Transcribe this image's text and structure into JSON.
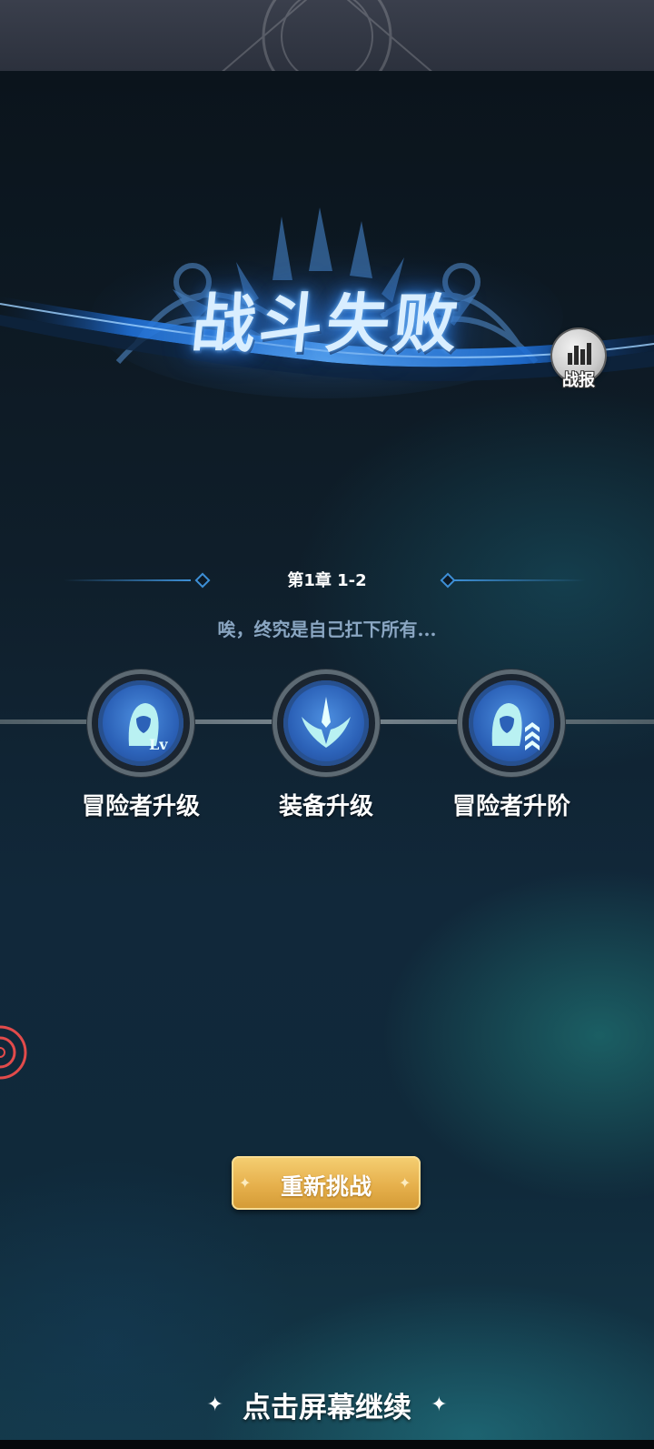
{
  "result": {
    "title": "战斗失败",
    "report_label": "战报"
  },
  "stage": {
    "chapter": "第1章 1-2",
    "subtitle": "唉，终究是自己扛下所有..."
  },
  "tips": [
    {
      "label": "冒险者升级",
      "icon": "adventurer-level-up-icon"
    },
    {
      "label": "装备升级",
      "icon": "equipment-upgrade-icon"
    },
    {
      "label": "冒险者升阶",
      "icon": "adventurer-rank-up-icon"
    }
  ],
  "actions": {
    "retry_label": "重新挑战",
    "continue_label": "点击屏幕继续"
  },
  "colors": {
    "title_glow": "#2f7fe0",
    "retry_button": "#e6b04c",
    "tip_disc": "#2c62b8",
    "side_ring": "#e24b4b"
  }
}
